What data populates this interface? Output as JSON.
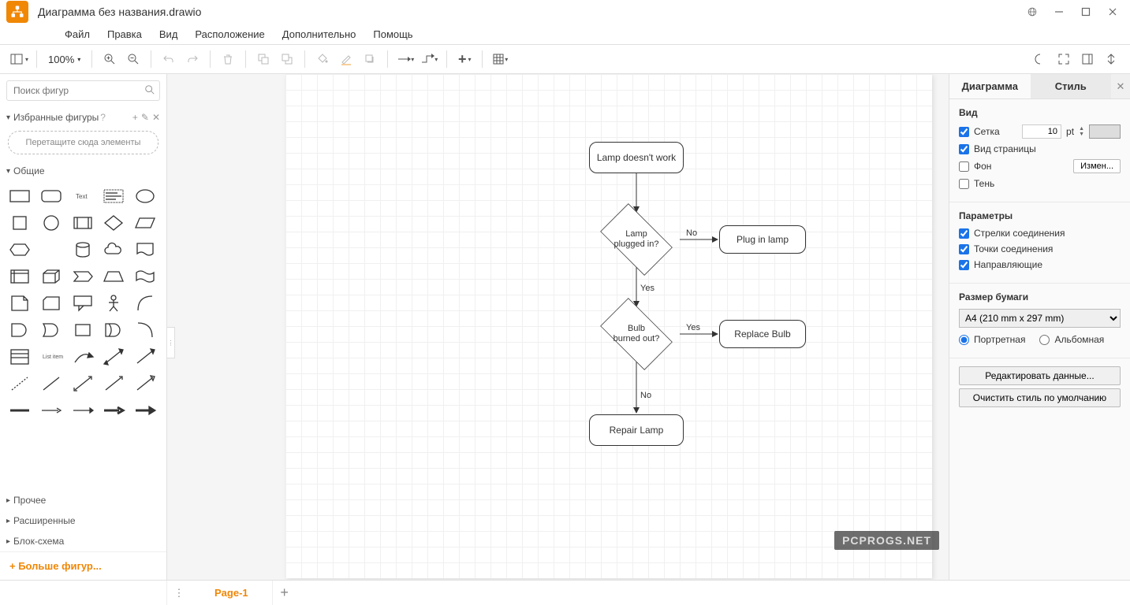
{
  "title": "Диаграмма без названия.drawio",
  "menu": [
    "Файл",
    "Правка",
    "Вид",
    "Расположение",
    "Дополнительно",
    "Помощь"
  ],
  "zoom": "100%",
  "search_placeholder": "Поиск фигур",
  "sidebar": {
    "favorites": "Избранные фигуры",
    "dropzone": "Перетащите сюда элементы",
    "general": "Общие",
    "misc": "Прочее",
    "advanced": "Расширенные",
    "flowchart": "Блок-схема",
    "more": "+ Больше фигур..."
  },
  "diagram": {
    "nodes": {
      "start": "Lamp doesn't work",
      "plugged": "Lamp\nplugged in?",
      "plugin": "Plug in lamp",
      "burned": "Bulb\nburned out?",
      "replace": "Replace Bulb",
      "repair": "Repair Lamp"
    },
    "labels": {
      "no": "No",
      "yes": "Yes"
    }
  },
  "right": {
    "tab_diagram": "Диаграмма",
    "tab_style": "Стиль",
    "view": "Вид",
    "grid": "Сетка",
    "grid_size": "10",
    "grid_unit": "pt",
    "page_view": "Вид страницы",
    "background": "Фон",
    "change": "Измен...",
    "shadow": "Тень",
    "params": "Параметры",
    "conn_arrows": "Стрелки соединения",
    "conn_points": "Точки соединения",
    "guides": "Направляющие",
    "paper": "Размер бумаги",
    "paper_size": "A4 (210 mm x 297 mm)",
    "portrait": "Портретная",
    "landscape": "Альбомная",
    "edit_data": "Редактировать данные...",
    "clear_style": "Очистить стиль по умолчанию"
  },
  "footer": {
    "page1": "Page-1"
  },
  "watermark": "PCPROGS.NET"
}
